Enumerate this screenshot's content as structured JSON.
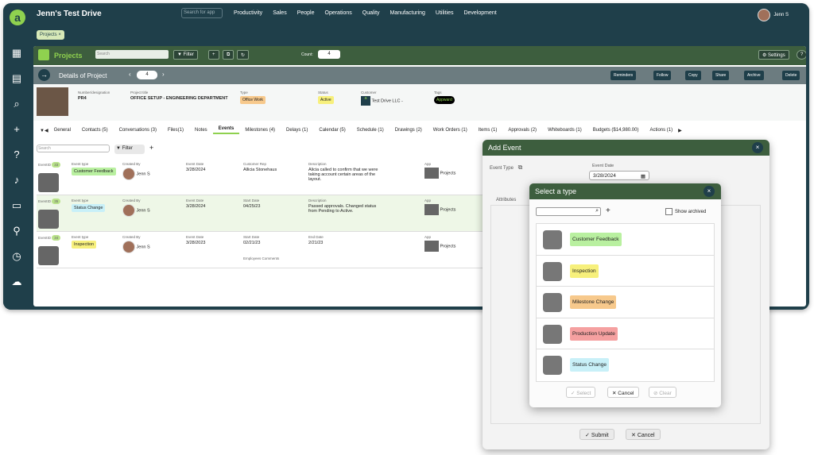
{
  "app": {
    "title": "Jenn's Test Drive",
    "search_placeholder": "Search for app",
    "nav": [
      "Productivity",
      "Sales",
      "People",
      "Operations",
      "Quality",
      "Manufacturing",
      "Utilities",
      "Development"
    ],
    "user": "Jenn S",
    "chip": "Projects ×"
  },
  "projects_bar": {
    "title": "Projects",
    "search_placeholder": "Search",
    "filter": "Filter",
    "count_label": "Count:",
    "count": "4",
    "settings": "Settings"
  },
  "details": {
    "title": "Details of Project",
    "page": "4",
    "actions": [
      "Reminders",
      "Follow",
      "Copy",
      "Share",
      "Archive",
      "Delete"
    ],
    "fields": [
      {
        "label": "Number/designation",
        "value": "PR4"
      },
      {
        "label": "Project title",
        "value": "OFFICE SETUP - ENGINEERING DEPARTMENT"
      },
      {
        "label": "Type",
        "value": "Office Work"
      },
      {
        "label": "Status",
        "value": "Active"
      },
      {
        "label": "Customer",
        "value": "Test Drive LLC -"
      },
      {
        "label": "Tags",
        "value": "Appward"
      }
    ]
  },
  "tabs": [
    "General",
    "Contacts (5)",
    "Conversations (3)",
    "Files(1)",
    "Notes",
    "Events",
    "Milestones (4)",
    "Delays (1)",
    "Calendar (5)",
    "Schedule (1)",
    "Drawings (2)",
    "Work Orders (1)",
    "Items (1)",
    "Approvals (2)",
    "Whiteboards (1)",
    "Budgets ($14,980.00)",
    "Actions (1)"
  ],
  "events_toolbar": {
    "search_placeholder": "Search",
    "filter": "Filter"
  },
  "events": [
    {
      "id": "33",
      "type": "Customer Feedback",
      "type_color": "#b9f0a0",
      "created_by": "Jenn S",
      "event_date": "3/28/2024",
      "c5_label": "Customer Rep",
      "c5_value": "Allicia Stonehaus",
      "c6_label": "Description",
      "c6_value": "Alicia called to confirm that we were taking account certain areas of the layout.",
      "app": "Projects"
    },
    {
      "id": "35",
      "type": "Status Change",
      "type_color": "#c8f0f8",
      "created_by": "Jenn S",
      "event_date": "3/28/2024",
      "c5_label": "Start Date",
      "c5_value": "04/25/23",
      "c6_label": "Description",
      "c6_value": "Passed approvals. Changed status from Pending to Active.",
      "app": "Projects"
    },
    {
      "id": "34",
      "type": "Inspection",
      "type_color": "#f7f07c",
      "created_by": "Jenn S",
      "event_date": "3/28/2023",
      "c5_label": "Start Date",
      "c5_value": "02/21/23",
      "c6_label": "End Date",
      "c6_value": "2/21/23",
      "app": "Projects",
      "extra": "Employees Comments"
    }
  ],
  "labels": {
    "event_id": "EventID",
    "event_type": "Event type",
    "created_by": "Created By",
    "event_date": "Event Date",
    "app": "App"
  },
  "add_event": {
    "title": "Add Event",
    "event_type_label": "Event Type",
    "event_date_label": "Event Date",
    "event_date": "3/28/2024",
    "attributes_label": "Attributes",
    "submit": "Submit",
    "cancel": "Cancel"
  },
  "select_type": {
    "title": "Select a type",
    "show_archived": "Show archived",
    "types": [
      {
        "label": "Customer Feedback",
        "color": "#b9f0a0"
      },
      {
        "label": "Inspection",
        "color": "#f7f07c"
      },
      {
        "label": "Milestone Change",
        "color": "#f7c98c"
      },
      {
        "label": "Production Update",
        "color": "#f5a0a0"
      },
      {
        "label": "Status Change",
        "color": "#c8f0f8"
      }
    ],
    "select": "Select",
    "cancel": "Cancel",
    "clear": "Clear"
  }
}
